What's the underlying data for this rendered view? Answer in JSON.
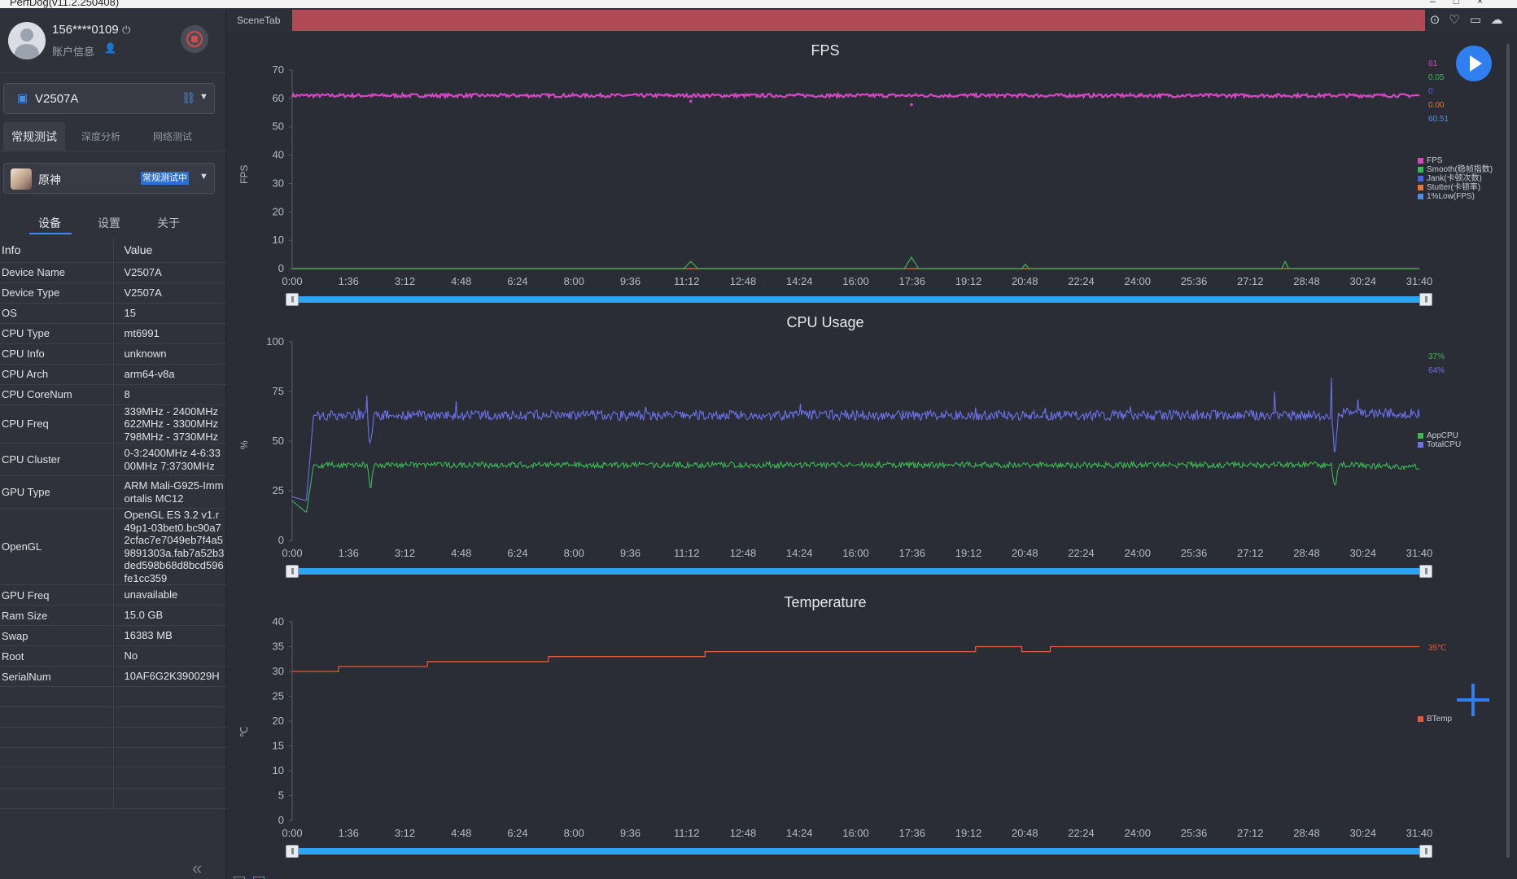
{
  "window": {
    "title": "PerfDog(v11.2.250408)"
  },
  "user": {
    "phone": "156****0109",
    "account_label": "账户信息"
  },
  "device": {
    "name": "V2507A"
  },
  "mode_tabs": [
    "常规测试",
    "深度分析",
    "网络测试"
  ],
  "app": {
    "name": "原神",
    "status": "常规测试中"
  },
  "sub_tabs": [
    "设备",
    "设置",
    "关于"
  ],
  "info_table": {
    "headers": [
      "Info",
      "Value"
    ],
    "rows": [
      {
        "key": "Device Name",
        "value": "V2507A"
      },
      {
        "key": "Device Type",
        "value": "V2507A"
      },
      {
        "key": "OS",
        "value": "15"
      },
      {
        "key": "CPU Type",
        "value": "mt6991"
      },
      {
        "key": "CPU Info",
        "value": "unknown"
      },
      {
        "key": "CPU Arch",
        "value": "arm64-v8a"
      },
      {
        "key": "CPU CoreNum",
        "value": "8"
      },
      {
        "key": "CPU Freq",
        "value": "339MHz - 2400MHz 622MHz - 3300MHz 798MHz - 3730MHz"
      },
      {
        "key": "CPU Cluster",
        "value": "0-3:2400MHz 4-6:3300MHz 7:3730MHz"
      },
      {
        "key": "GPU Type",
        "value": "ARM Mali-G925-Immortalis MC12"
      },
      {
        "key": "OpenGL",
        "value": "OpenGL ES 3.2 v1.r49p1-03bet0.bc90a72cfac7e7049eb7f4a59891303a.fab7a52b3ded598b68d8bcd596fe1cc359"
      },
      {
        "key": "GPU Freq",
        "value": "unavailable"
      },
      {
        "key": "Ram Size",
        "value": "15.0 GB"
      },
      {
        "key": "Swap",
        "value": "16383 MB"
      },
      {
        "key": "Root",
        "value": "No"
      },
      {
        "key": "SerialNum",
        "value": "10AF6G2K390029H"
      }
    ]
  },
  "scene_tab": {
    "label": "SceneTab"
  },
  "toolbar_icons": [
    "location-pin-icon",
    "marker-icon",
    "folder-icon",
    "cloud-icon"
  ],
  "charts": [
    {
      "title": "FPS",
      "ylabel": "FPS",
      "ylim": [
        0,
        70
      ],
      "yticks": [
        0,
        10,
        20,
        30,
        40,
        50,
        60,
        70
      ],
      "xticks": [
        "0:00",
        "1:36",
        "3:12",
        "4:48",
        "6:24",
        "8:00",
        "9:36",
        "11:12",
        "12:48",
        "14:24",
        "16:00",
        "17:36",
        "19:12",
        "20:48",
        "22:24",
        "24:00",
        "25:36",
        "27:12",
        "28:48",
        "30:24",
        "31:40"
      ],
      "legend": [
        "FPS",
        "Smooth(稳帧指数)",
        "Jank(卡顿次数)",
        "Stutter(卡顿率)",
        "1%Low(FPS)"
      ],
      "colors": [
        "#d647c3",
        "#3cb853",
        "#4a62e8",
        "#e8772e",
        "#4a90e2"
      ],
      "current_values": [
        "61",
        "0.05",
        "0",
        "0.00",
        "60.51"
      ]
    },
    {
      "title": "CPU Usage",
      "ylabel": "%",
      "ylim": [
        0,
        100
      ],
      "yticks": [
        0,
        25,
        50,
        75,
        100
      ],
      "xticks": [
        "0:00",
        "1:36",
        "3:12",
        "4:48",
        "6:24",
        "8:00",
        "9:36",
        "11:12",
        "12:48",
        "14:24",
        "16:00",
        "17:36",
        "19:12",
        "20:48",
        "22:24",
        "24:00",
        "25:36",
        "27:12",
        "28:48",
        "30:24",
        "31:40"
      ],
      "legend": [
        "AppCPU",
        "TotalCPU"
      ],
      "colors": [
        "#3cb853",
        "#6a72e8"
      ],
      "current_values": [
        "37%",
        "64%"
      ]
    },
    {
      "title": "Temperature",
      "ylabel": "℃",
      "ylim": [
        0,
        40
      ],
      "yticks": [
        0,
        5,
        10,
        15,
        20,
        25,
        30,
        35,
        40
      ],
      "xticks": [
        "0:00",
        "1:36",
        "3:12",
        "4:48",
        "6:24",
        "8:00",
        "9:36",
        "11:12",
        "12:48",
        "14:24",
        "16:00",
        "17:36",
        "19:12",
        "20:48",
        "22:24",
        "24:00",
        "25:36",
        "27:12",
        "28:48",
        "30:24",
        "31:40"
      ],
      "legend": [
        "BTemp"
      ],
      "colors": [
        "#e05a3d"
      ],
      "current_values": [
        "35℃"
      ]
    }
  ],
  "chart_data": [
    {
      "type": "line",
      "title": "FPS",
      "ylabel": "FPS",
      "ylim": [
        0,
        70
      ],
      "x_minutes": [
        0,
        11.2,
        11.4,
        17.4,
        17.6,
        27.2,
        31.67
      ],
      "series": [
        {
          "name": "FPS",
          "values": [
            61,
            61,
            59.5,
            61,
            58,
            61,
            61
          ]
        },
        {
          "name": "Smooth(稳帧指数)",
          "values": [
            0,
            0,
            2,
            0,
            4,
            2,
            0
          ]
        },
        {
          "name": "Jank(卡顿次数)",
          "values": [
            0,
            0,
            0,
            0,
            0,
            0,
            0
          ]
        },
        {
          "name": "Stutter(卡顿率)",
          "values": [
            0,
            0,
            0,
            0,
            0,
            0,
            0
          ]
        },
        {
          "name": "1%Low(FPS)",
          "values": [
            60.5,
            60.5,
            60.5,
            60.5,
            60.5,
            60.5,
            60.5
          ]
        }
      ]
    },
    {
      "type": "line",
      "title": "CPU Usage",
      "ylabel": "%",
      "ylim": [
        0,
        100
      ],
      "x_minutes": [
        0,
        0.4,
        0.6,
        2.1,
        2.2,
        2.3,
        29.2,
        29.3,
        29.4,
        31.67
      ],
      "series": [
        {
          "name": "AppCPU",
          "values": [
            20,
            14,
            38,
            38,
            26,
            38,
            38,
            26,
            38,
            37
          ]
        },
        {
          "name": "TotalCPU",
          "values": [
            22,
            20,
            63,
            63,
            46,
            63,
            63,
            41,
            64,
            64
          ]
        }
      ]
    },
    {
      "type": "line",
      "title": "Temperature",
      "ylabel": "℃",
      "ylim": [
        0,
        40
      ],
      "x_minutes": [
        0,
        1.3,
        3.8,
        7.2,
        11.6,
        19.2,
        20.5,
        21.3,
        31.67
      ],
      "series": [
        {
          "name": "BTemp",
          "values": [
            30,
            31,
            32,
            33,
            34,
            35,
            34,
            35,
            35
          ]
        }
      ]
    }
  ]
}
